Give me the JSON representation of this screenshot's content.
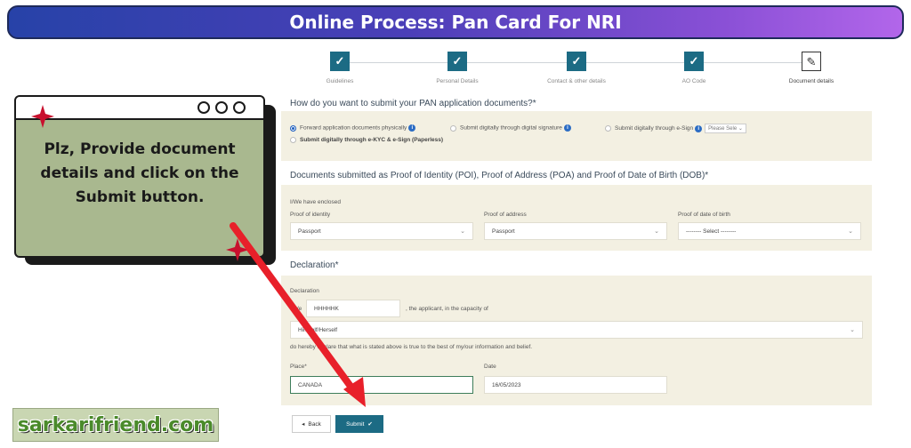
{
  "banner": {
    "title": "Online Process: Pan Card For NRI"
  },
  "stepper": {
    "steps": [
      {
        "label": "Guidelines",
        "icon": "check-icon"
      },
      {
        "label": "Personal Details",
        "icon": "check-icon"
      },
      {
        "label": "Contact & other details",
        "icon": "check-icon"
      },
      {
        "label": "AO Code",
        "icon": "check-icon"
      },
      {
        "label": "Document details",
        "icon": "edit-icon"
      }
    ]
  },
  "submission": {
    "question": "How do you want to submit your PAN application documents?*",
    "options": [
      {
        "label": "Forward application documents physically",
        "checked": true
      },
      {
        "label": "Submit digitally through digital signature",
        "checked": false
      },
      {
        "label": "Submit digitally through e-Sign",
        "checked": false
      },
      {
        "label": "Submit digitally through e-KYC & e-Sign (Paperless)",
        "checked": false
      }
    ],
    "esign_select": "Please Sele"
  },
  "documents": {
    "title": "Documents submitted as Proof of Identity (POI), Proof of Address (POA) and Proof of Date of Birth (DOB)*",
    "enclosed_label": "I/We have enclosed",
    "poi_label": "Proof of identity",
    "poi_value": "Passport",
    "poa_label": "Proof of address",
    "poa_value": "Passport",
    "dob_label": "Proof of date of birth",
    "dob_value": "-------- Select --------"
  },
  "declaration": {
    "title": "Declaration*",
    "label": "Declaration",
    "prefix": "I/We",
    "name_value": "HHHHHK",
    "capacity_text": ", the applicant, in the capacity of",
    "capacity_value": "Himself/Herself",
    "statement": "do hereby declare that what is stated above is true to the best of my/our information and belief.",
    "place_label": "Place*",
    "place_value": "CANADA",
    "date_label": "Date",
    "date_value": "16/05/2023"
  },
  "buttons": {
    "back": "Back",
    "submit": "Submit"
  },
  "callout": {
    "text": "Plz, Provide document details and click on the Submit button."
  },
  "brand": {
    "text": "sarkarifriend.com"
  },
  "colors": {
    "accent": "#1c6b84",
    "arrow": "#e8202a",
    "callout_bg": "#a9b88f",
    "sparkle": "#c8102e"
  }
}
